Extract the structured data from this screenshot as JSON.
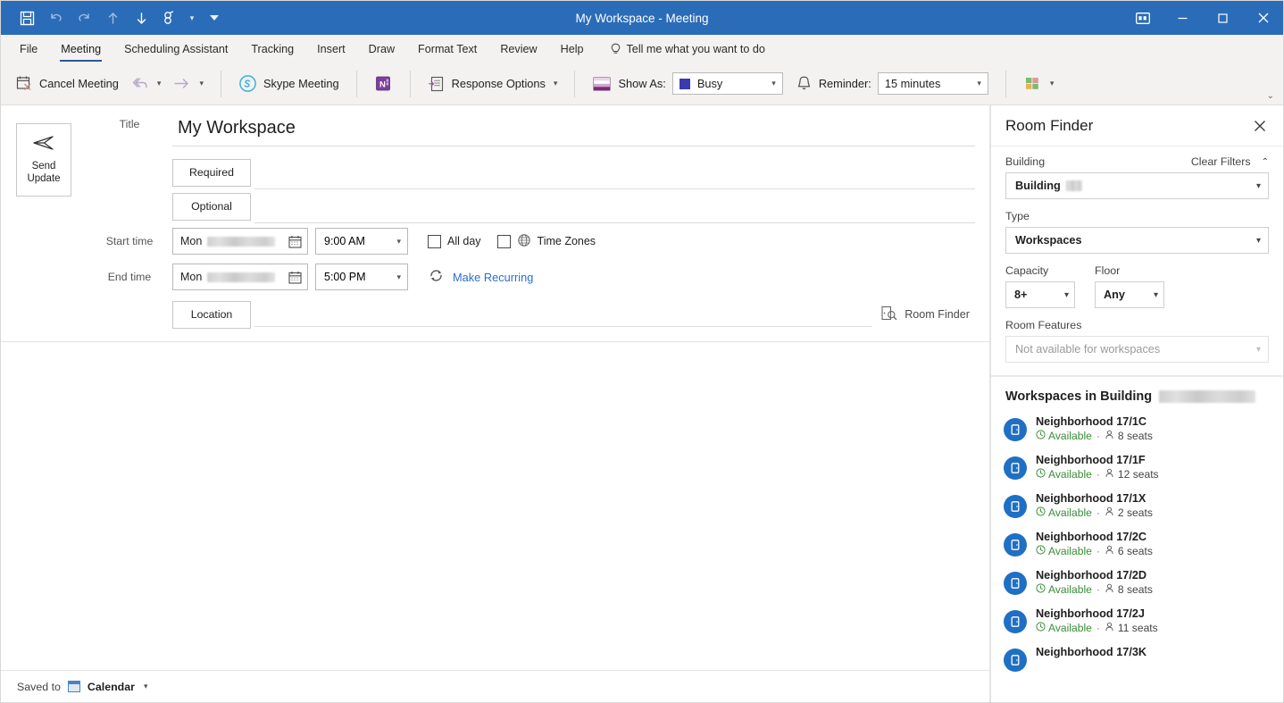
{
  "window": {
    "title": "My Workspace - Meeting",
    "quick_access": [
      {
        "name": "save-icon",
        "label": "Save"
      },
      {
        "name": "undo-icon",
        "label": "Undo"
      },
      {
        "name": "redo-icon",
        "label": "Redo"
      },
      {
        "name": "previous-item-icon",
        "label": "Previous Item"
      },
      {
        "name": "next-item-icon",
        "label": "Next Item"
      },
      {
        "name": "link-icon",
        "label": "Link"
      }
    ],
    "controls": {
      "ribbon_display": "Ribbon Display Options",
      "minimize": "Minimize",
      "maximize": "Maximize",
      "close": "Close"
    },
    "accent_color": "#2b6cb8"
  },
  "ribbon": {
    "tabs": [
      {
        "label": "File",
        "active": false
      },
      {
        "label": "Meeting",
        "active": true
      },
      {
        "label": "Scheduling Assistant",
        "active": false
      },
      {
        "label": "Tracking",
        "active": false
      },
      {
        "label": "Insert",
        "active": false
      },
      {
        "label": "Draw",
        "active": false
      },
      {
        "label": "Format Text",
        "active": false
      },
      {
        "label": "Review",
        "active": false
      },
      {
        "label": "Help",
        "active": false
      }
    ],
    "tell_me": "Tell me what you want to do",
    "commands": {
      "cancel_meeting": "Cancel Meeting",
      "skype_meeting": "Skype Meeting",
      "response_options": "Response Options",
      "show_as_label": "Show As:",
      "show_as_value": "Busy",
      "show_as_color": "#3b3bb0",
      "reminder_label": "Reminder:",
      "reminder_value": "15 minutes"
    }
  },
  "compose": {
    "send_button": {
      "line1": "Send",
      "line2": "Update"
    },
    "title_label": "Title",
    "title_value": "My Workspace",
    "required_label": "Required",
    "required_value": "",
    "optional_label": "Optional",
    "optional_value": "",
    "start_time_label": "Start time",
    "start_date_day": "Mon",
    "start_date_value": "",
    "start_time_value": "9:00 AM",
    "end_time_label": "End time",
    "end_date_day": "Mon",
    "end_date_value": "",
    "end_time_value": "5:00 PM",
    "all_day_label": "All day",
    "all_day_checked": false,
    "time_zones_label": "Time Zones",
    "time_zones_checked": false,
    "make_recurring_label": "Make Recurring",
    "make_recurring_color": "#2a6fc9",
    "location_label": "Location",
    "location_value": "",
    "room_finder_label": "Room Finder"
  },
  "status_bar": {
    "saved_to_label": "Saved to",
    "calendar_name": "Calendar"
  },
  "room_finder": {
    "title": "Room Finder",
    "building_label": "Building",
    "clear_filters_label": "Clear Filters",
    "building_value": "Building",
    "type_label": "Type",
    "type_value": "Workspaces",
    "capacity_label": "Capacity",
    "capacity_value": "8+",
    "floor_label": "Floor",
    "floor_value": "Any",
    "room_features_label": "Room Features",
    "room_features_value": "Not available for workspaces",
    "list_heading": "Workspaces in Building",
    "workspaces": [
      {
        "name": "Neighborhood 17/1C",
        "status": "Available",
        "seats": "8 seats"
      },
      {
        "name": "Neighborhood 17/1F",
        "status": "Available",
        "seats": "12 seats"
      },
      {
        "name": "Neighborhood 17/1X",
        "status": "Available",
        "seats": "2 seats"
      },
      {
        "name": "Neighborhood 17/2C",
        "status": "Available",
        "seats": "6 seats"
      },
      {
        "name": "Neighborhood 17/2D",
        "status": "Available",
        "seats": "8 seats"
      },
      {
        "name": "Neighborhood 17/2J",
        "status": "Available",
        "seats": "11 seats"
      },
      {
        "name": "Neighborhood 17/3K",
        "status": "",
        "seats": ""
      }
    ],
    "available_color": "#3a8c3a",
    "avatar_color": "#1f6fc4"
  }
}
